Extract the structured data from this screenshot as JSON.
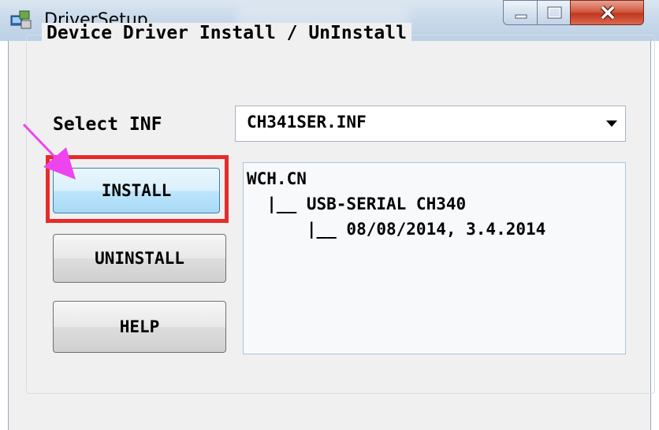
{
  "window": {
    "title": "DriverSetup"
  },
  "group": {
    "legend": "Device Driver Install / UnInstall"
  },
  "inf": {
    "label": "Select INF",
    "selected": "CH341SER.INF"
  },
  "info": {
    "lines": [
      "WCH.CN",
      "  |__ USB-SERIAL CH340",
      "      |__ 08/08/2014, 3.4.2014"
    ]
  },
  "buttons": {
    "install": "INSTALL",
    "uninstall": "UNINSTALL",
    "help": "HELP"
  },
  "annotation": {
    "highlight_color": "#e82a2a",
    "arrow_color": "#ee44ee"
  }
}
